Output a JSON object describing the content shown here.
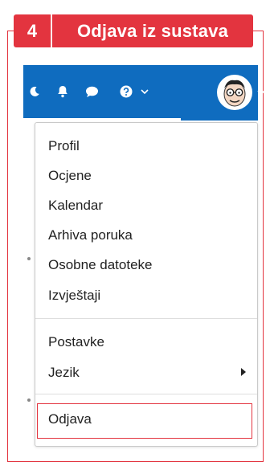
{
  "banner": {
    "number": "4",
    "title": "Odjava iz sustava"
  },
  "navbar": {
    "icons": [
      "moon-icon",
      "bell-icon",
      "chat-icon",
      "help-icon",
      "chevron-down-icon",
      "avatar",
      "chevron-down-icon"
    ],
    "accent": "#0f6cbf"
  },
  "menu": {
    "items": [
      {
        "label": "Profil"
      },
      {
        "label": "Ocjene"
      },
      {
        "label": "Kalendar"
      },
      {
        "label": "Arhiva poruka"
      },
      {
        "label": "Osobne datoteke"
      },
      {
        "label": "Izvještaji"
      }
    ],
    "section2": [
      {
        "label": "Postavke"
      },
      {
        "label": "Jezik"
      }
    ],
    "logout": "Odjava"
  },
  "colors": {
    "highlight": "#e3343f",
    "nav": "#0f6cbf"
  }
}
